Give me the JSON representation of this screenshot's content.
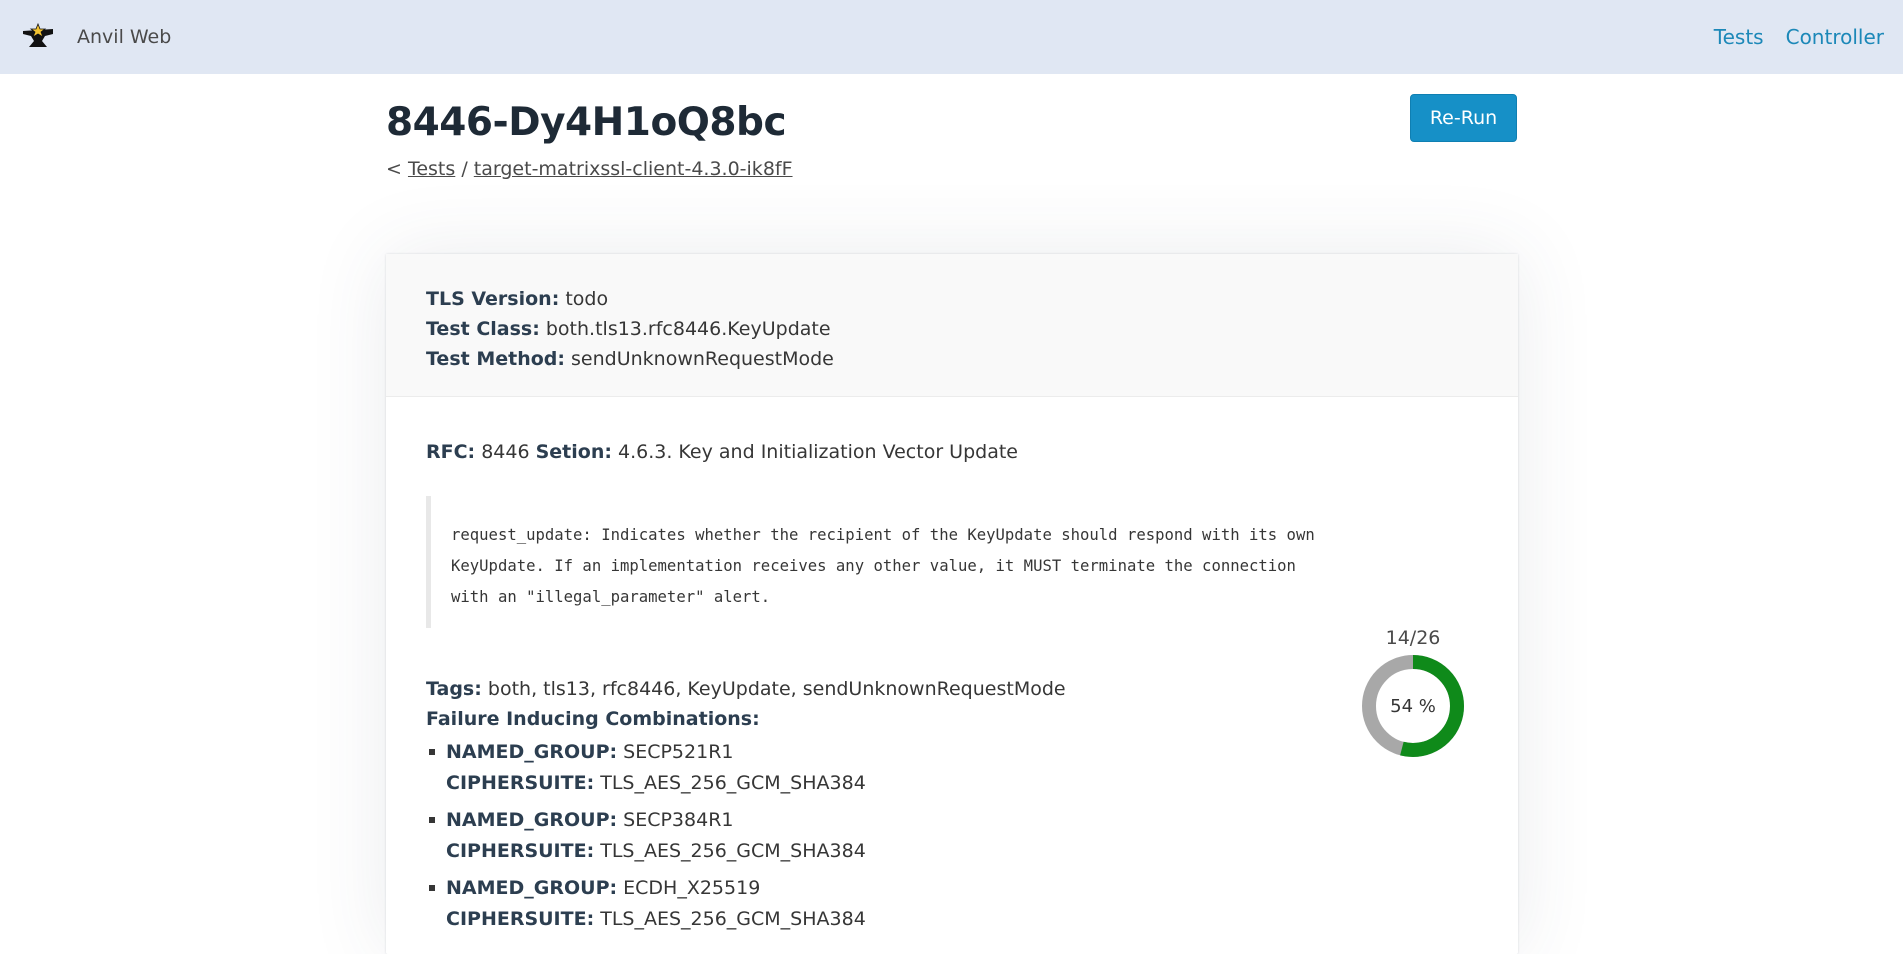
{
  "navbar": {
    "brand": "Anvil Web",
    "links": [
      "Tests",
      "Controller"
    ]
  },
  "header": {
    "title": "8446-Dy4H1oQ8bc",
    "rerun_label": "Re-Run",
    "breadcrumb": {
      "prefix": "<",
      "tests_link": "Tests",
      "separator": "/",
      "target_link": "target-matrixssl-client-4.3.0-ik8fF"
    }
  },
  "details": {
    "tls_version_label": "TLS Version:",
    "tls_version": "todo",
    "test_class_label": "Test Class:",
    "test_class": "both.tls13.rfc8446.KeyUpdate",
    "test_method_label": "Test Method:",
    "test_method": "sendUnknownRequestMode",
    "rfc_label": "RFC:",
    "rfc": "8446",
    "section_label": "Setion:",
    "section": "4.6.3. Key and Initialization Vector Update",
    "quote": "request_update: Indicates whether the recipient of the KeyUpdate should respond with its own\nKeyUpdate. If an implementation receives any other value, it MUST terminate the connection\nwith an \"illegal_parameter\" alert.",
    "tags_label": "Tags:",
    "tags": "both, tls13, rfc8446, KeyUpdate, sendUnknownRequestMode",
    "failure_label": "Failure Inducing Combinations:",
    "combinations": [
      {
        "k1": "NAMED_GROUP:",
        "v1": "SECP521R1",
        "k2": "CIPHERSUITE:",
        "v2": "TLS_AES_256_GCM_SHA384"
      },
      {
        "k1": "NAMED_GROUP:",
        "v1": "SECP384R1",
        "k2": "CIPHERSUITE:",
        "v2": "TLS_AES_256_GCM_SHA384"
      },
      {
        "k1": "NAMED_GROUP:",
        "v1": "ECDH_X25519",
        "k2": "CIPHERSUITE:",
        "v2": "TLS_AES_256_GCM_SHA384"
      }
    ]
  },
  "progress": {
    "count": "14/26",
    "percent_label": "54 %",
    "fraction": 0.54,
    "colors": {
      "done": "#0f8a1a",
      "rest": "#a8a8a8"
    }
  }
}
